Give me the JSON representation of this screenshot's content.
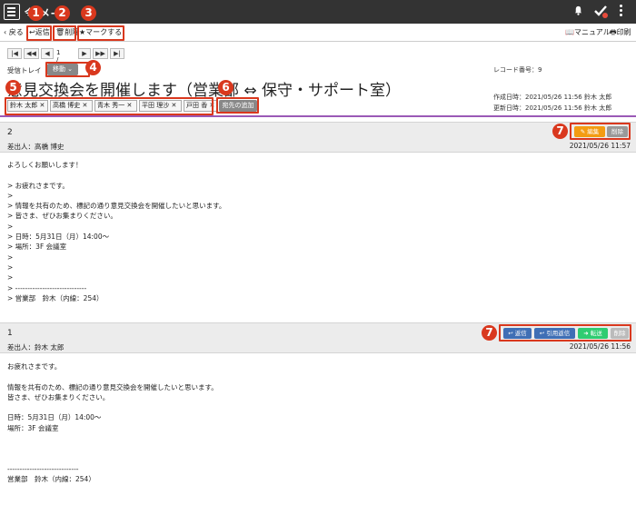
{
  "header": {
    "title": "令 メ-"
  },
  "toolbar": {
    "back": "戻る",
    "reply": "返信",
    "delete": "削除",
    "mark": "マークする",
    "manual": "マニュアル",
    "print": "印刷"
  },
  "pager": {
    "first": "|◀",
    "prev_fast": "◀◀",
    "prev": "◀",
    "page": "1 / 6",
    "next": "▶",
    "next_fast": "▶▶",
    "last": "▶|"
  },
  "folder": {
    "label": "受信トレイ",
    "move": "移動"
  },
  "subject": "意見交換会を開催します（営業部 ⇔ 保守・サポート室）",
  "record": {
    "label": "レコード番号：9",
    "created": "作成日時：2021/05/26 11:56 鈴木 太郎",
    "updated": "更新日時：2021/05/26 11:56 鈴木 太郎"
  },
  "recipients": [
    "鈴木 太郎",
    "高橋 博史",
    "青木 秀一",
    "平田 理沙",
    "戸田 香"
  ],
  "add_recipient": "宛先の追加",
  "badges": [
    "1",
    "2",
    "3",
    "4",
    "5",
    "6",
    "7",
    "7"
  ],
  "messages": [
    {
      "number": "2",
      "from": "差出人：高橋 博史",
      "date": "2021/05/26 11:57",
      "actions": {
        "edit": "編集",
        "delete": "削除"
      },
      "body": "よろしくお願いします！\n\n> お疲れさまです。\n>\n> 情報を共有のため、標記の通り意見交換会を開催したいと思います。\n> 皆さま、ぜひお集まりください。\n>\n> 日時：5月31日（月）14:00～\n> 場所：3F 会議室\n>\n>\n>\n> -----------------------------\n> 営業部　鈴木（内線：254）"
    },
    {
      "number": "1",
      "from": "差出人：鈴木 太郎",
      "date": "2021/05/26 11:56",
      "actions": {
        "reply": "返信",
        "quote_reply": "引用返信",
        "forward": "転送",
        "delete": "削除"
      },
      "body": "お疲れさまです。\n\n情報を共有のため、標記の通り意見交換会を開催したいと思います。\n皆さま、ぜひお集まりください。\n\n日時：5月31日（月）14:00～\n場所：3F 会議室\n\n\n\n-----------------------------\n営業部　鈴木（内線：254）"
    }
  ],
  "colors": {
    "topbar": "#333333",
    "accent_red": "#d9381e",
    "edit": "#f39c12",
    "reply": "#3f6fb5",
    "forward": "#2ecc71",
    "neutral": "#999999",
    "divider": "#9b59b6"
  }
}
